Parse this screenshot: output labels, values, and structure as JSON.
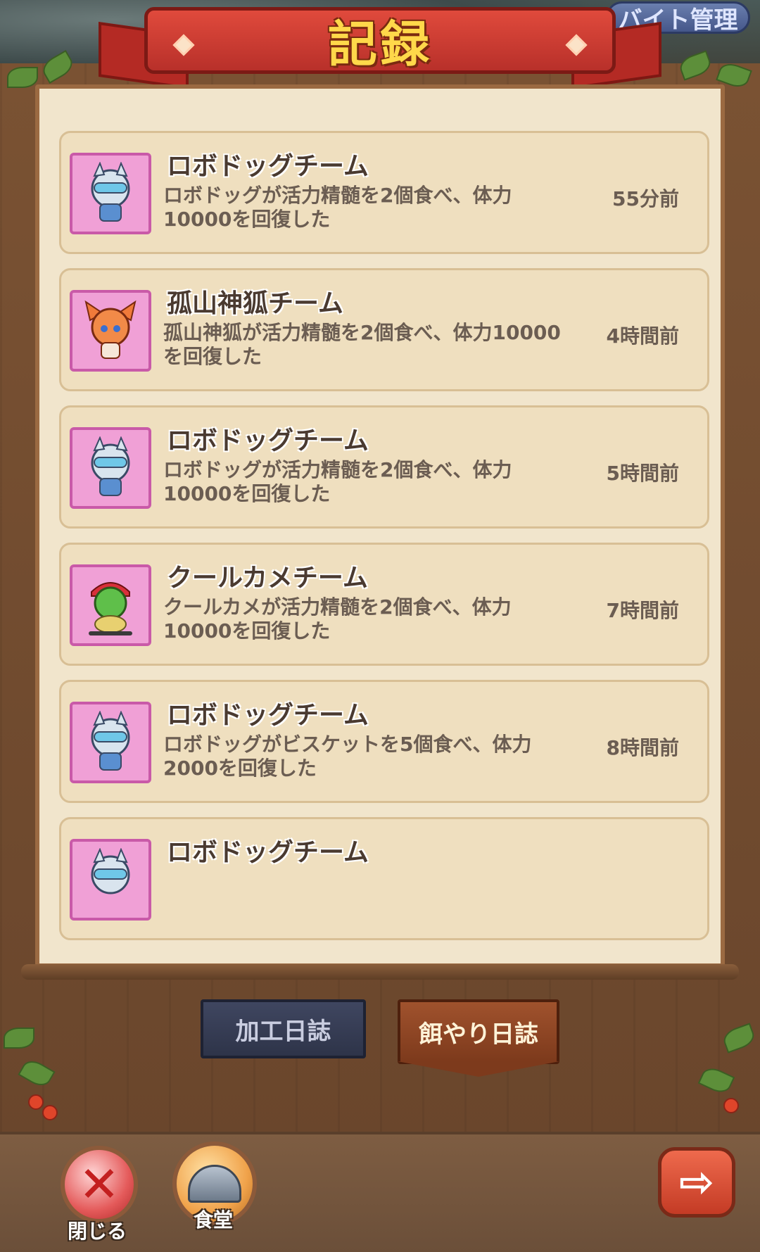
{
  "header": {
    "title": "記録",
    "manage_button": "バイト管理"
  },
  "logs": [
    {
      "team": "ロボドッグチーム",
      "description": "ロボドッグが活力精髄を2個食べ、体力10000を回復した",
      "time": "55分前",
      "avatar_icon": "robo-dog-icon"
    },
    {
      "team": "孤山神狐チーム",
      "description": "孤山神狐が活力精髄を2個食べ、体力10000を回復した",
      "time": "4時間前",
      "avatar_icon": "fox-icon"
    },
    {
      "team": "ロボドッグチーム",
      "description": "ロボドッグが活力精髄を2個食べ、体力10000を回復した",
      "time": "5時間前",
      "avatar_icon": "robo-dog-icon"
    },
    {
      "team": "クールカメチーム",
      "description": "クールカメが活力精髄を2個食べ、体力10000を回復した",
      "time": "7時間前",
      "avatar_icon": "turtle-icon"
    },
    {
      "team": "ロボドッグチーム",
      "description": "ロボドッグがビスケットを5個食べ、体力2000を回復した",
      "time": "8時間前",
      "avatar_icon": "robo-dog-icon"
    },
    {
      "team": "ロボドッグチーム",
      "description": "",
      "time": "",
      "avatar_icon": "robo-dog-icon"
    }
  ],
  "tabs": {
    "processing_log": "加工日誌",
    "feeding_log": "餌やり日誌"
  },
  "bottom": {
    "close_label": "閉じる",
    "dining_label": "食堂"
  }
}
